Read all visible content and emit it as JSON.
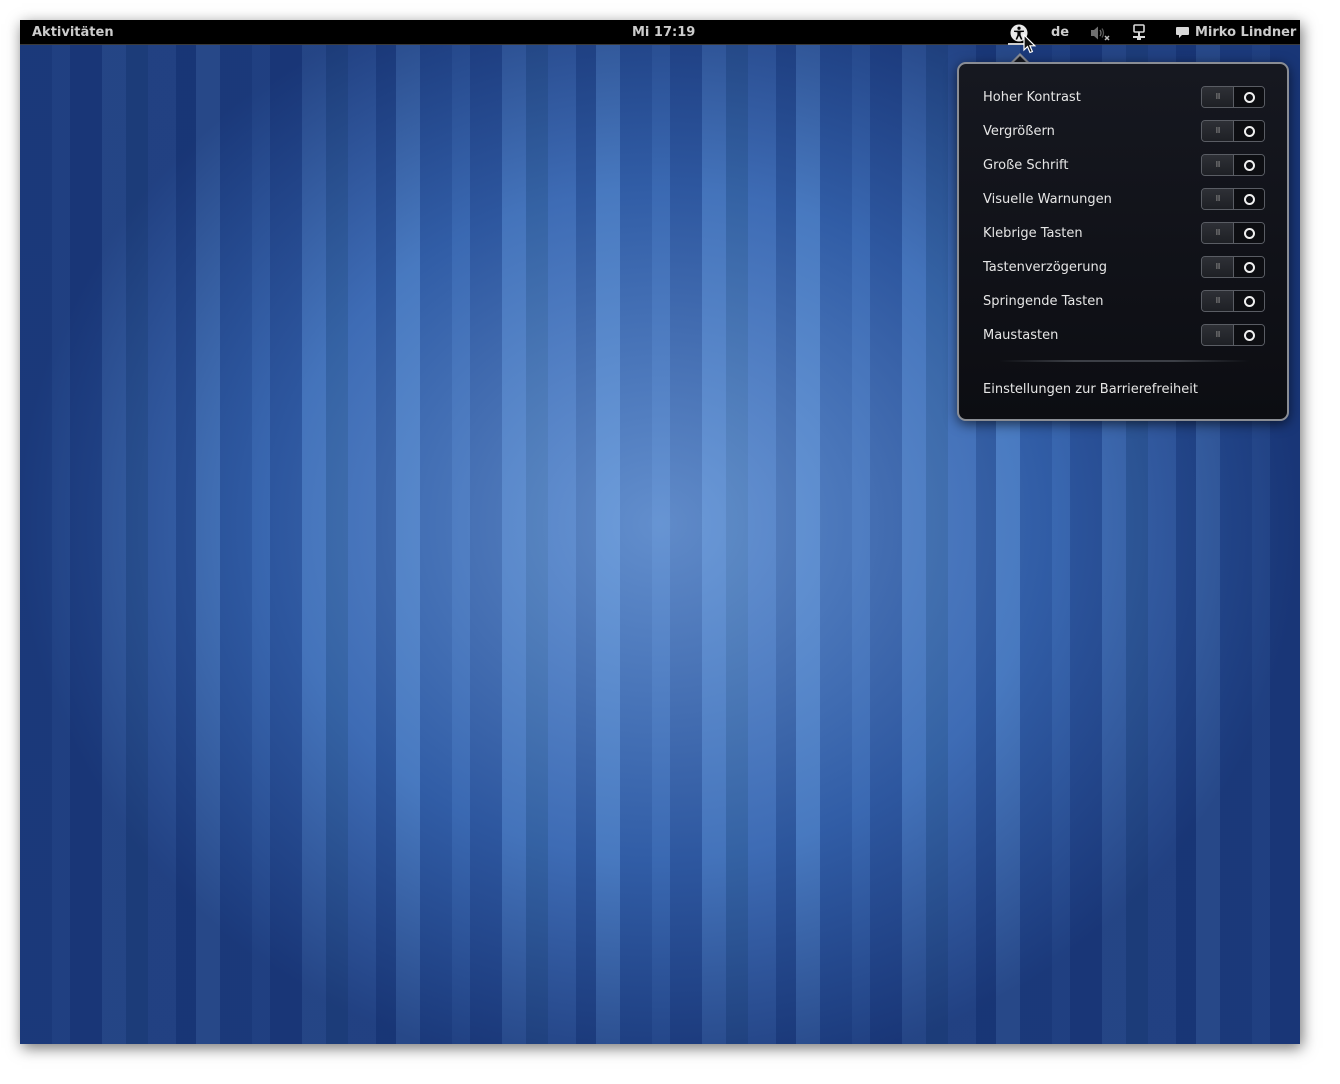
{
  "topbar": {
    "activities": "Aktivitäten",
    "clock": "Mi 17:19",
    "keyboard_layout": "de",
    "user_name": "Mirko Lindner",
    "icons": [
      "accessibility-icon",
      "volume-muted-icon",
      "network-wired-icon",
      "chat-status-icon"
    ]
  },
  "accessibility_menu": {
    "items": [
      {
        "label": "Hoher Kontrast",
        "state": "off"
      },
      {
        "label": "Vergrößern",
        "state": "off"
      },
      {
        "label": "Große Schrift",
        "state": "off"
      },
      {
        "label": "Visuelle Warnungen",
        "state": "off"
      },
      {
        "label": "Klebrige Tasten",
        "state": "off"
      },
      {
        "label": "Tastenverzögerung",
        "state": "off"
      },
      {
        "label": "Springende Tasten",
        "state": "off"
      },
      {
        "label": "Maustasten",
        "state": "off"
      }
    ],
    "toggle_on_mark": "III",
    "settings_label": "Einstellungen zur Barrierefreiheit"
  },
  "colors": {
    "topbar_bg": "#000000",
    "desktop_blue": "#3a68b0",
    "menu_bg": "#111218",
    "menu_border": "#8a8d94"
  }
}
